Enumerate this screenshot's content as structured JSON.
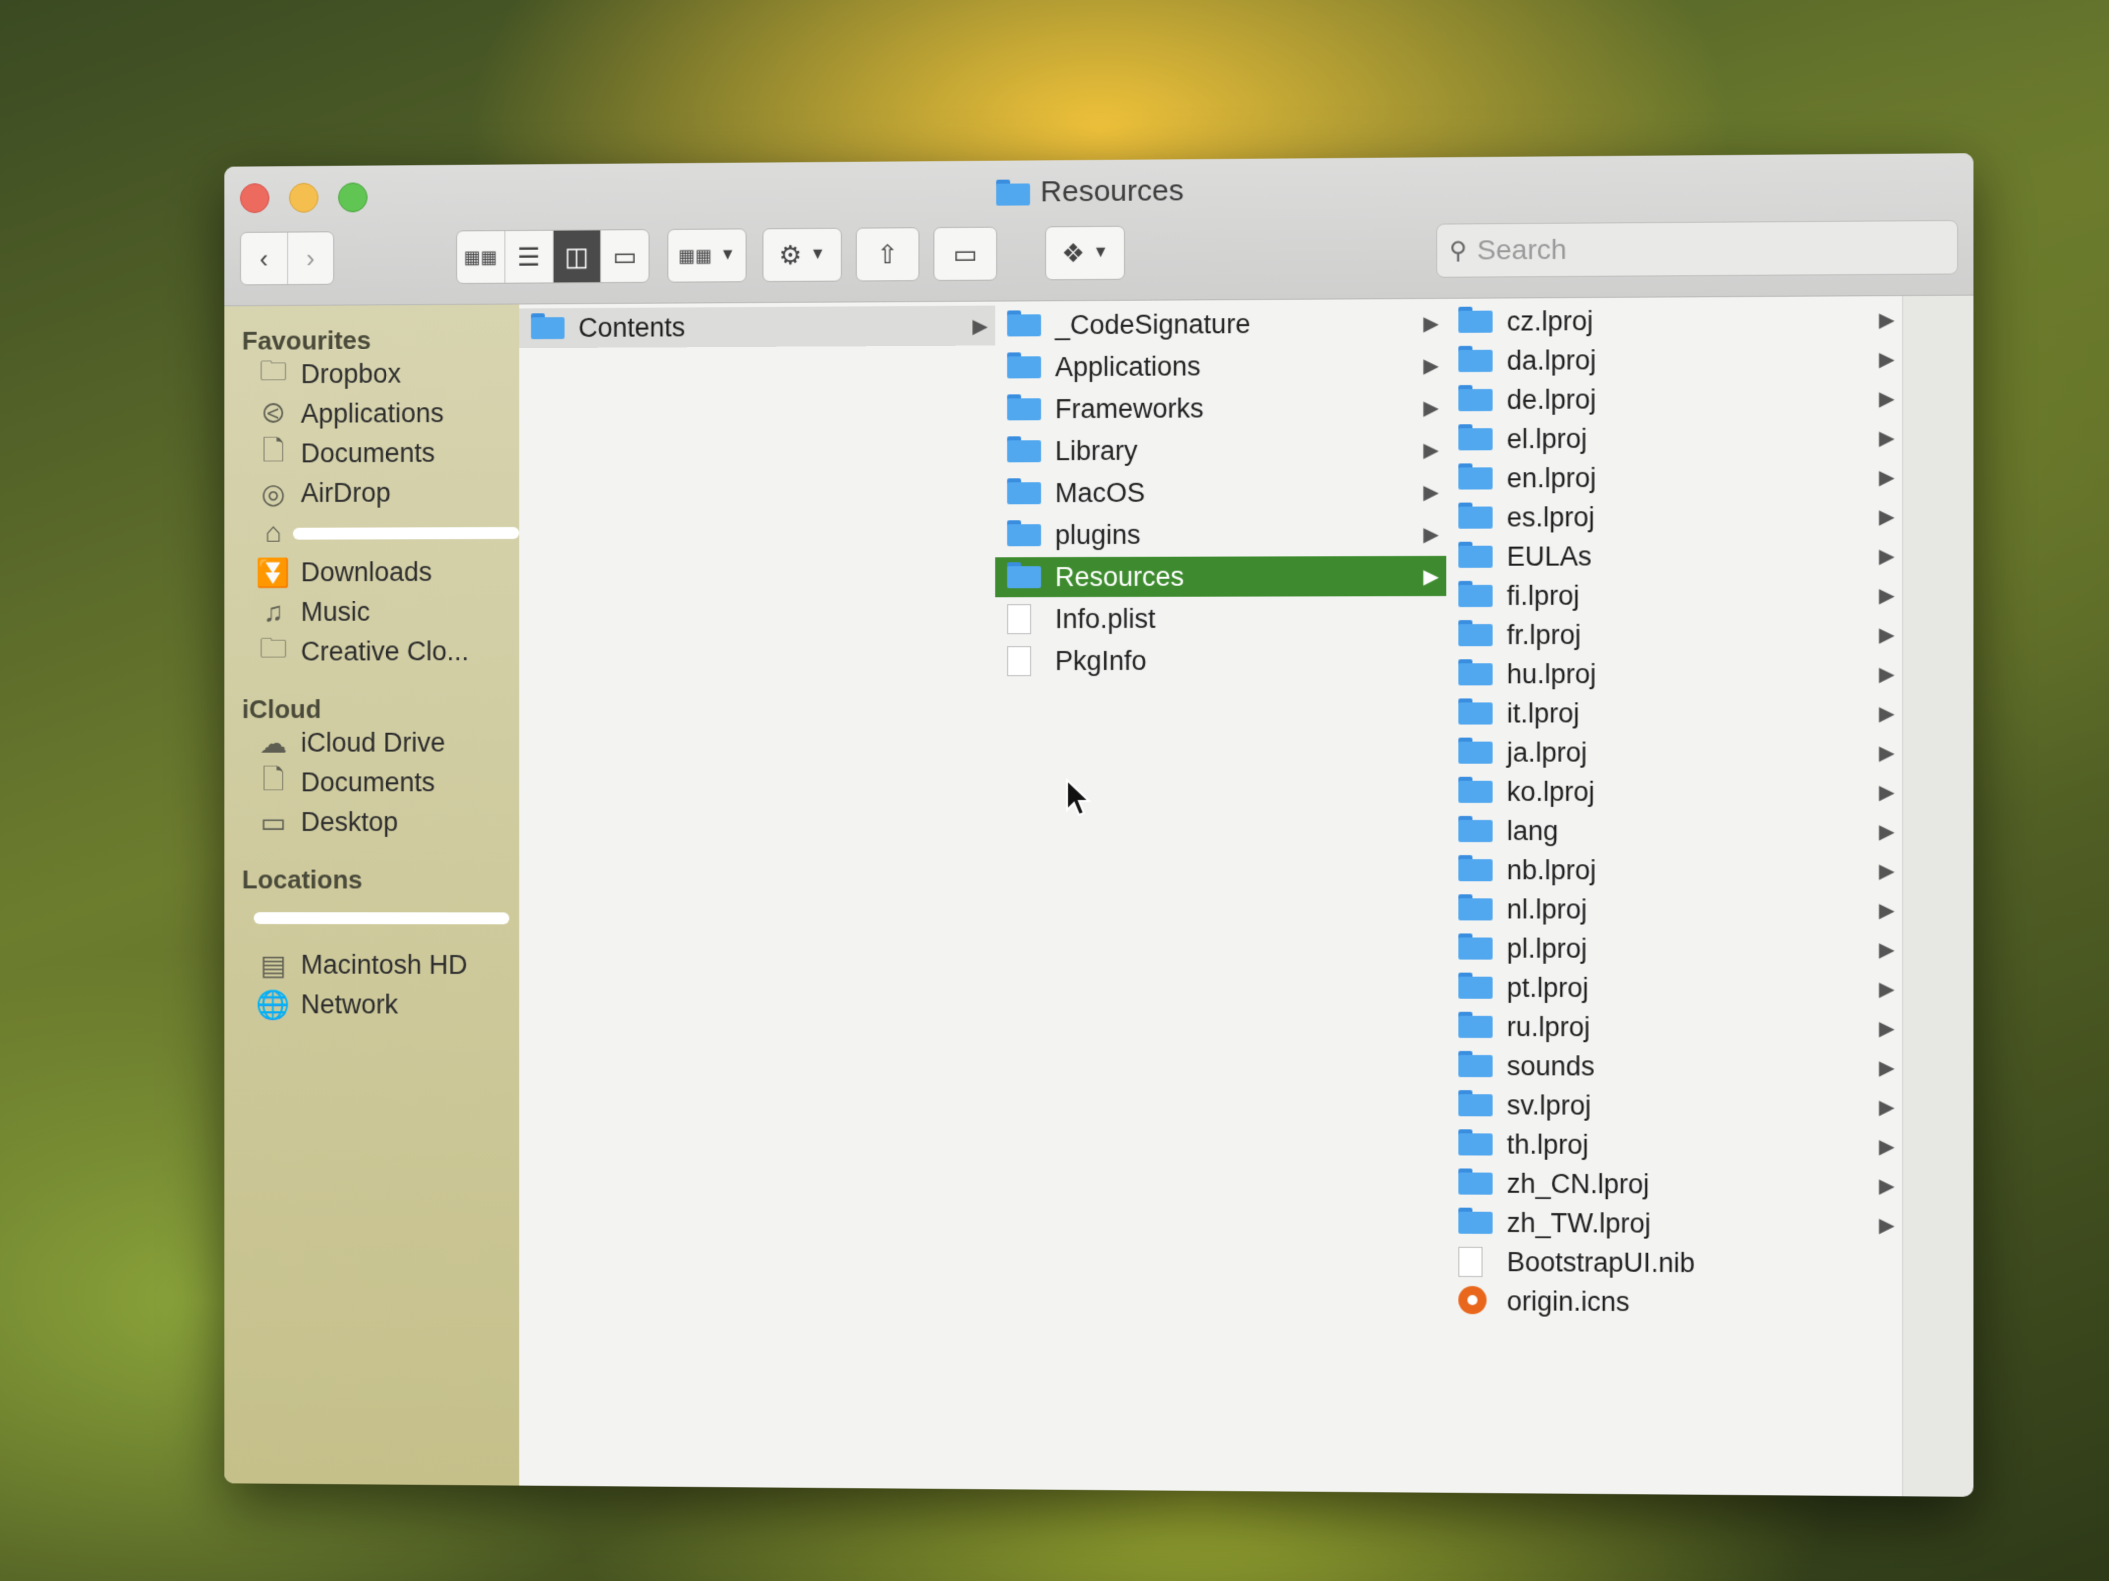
{
  "window": {
    "title": "Resources"
  },
  "search": {
    "placeholder": "Search"
  },
  "sidebar": {
    "favourites_heading": "Favourites",
    "favourites": [
      {
        "label": "Dropbox",
        "icon": "folder-icon"
      },
      {
        "label": "Applications",
        "icon": "applications-icon"
      },
      {
        "label": "Documents",
        "icon": "documents-icon"
      },
      {
        "label": "AirDrop",
        "icon": "airdrop-icon"
      },
      {
        "label": "Downloads",
        "icon": "downloads-icon"
      },
      {
        "label": "Music",
        "icon": "music-icon"
      },
      {
        "label": "Creative Clo...",
        "icon": "folder-icon"
      }
    ],
    "icloud_heading": "iCloud",
    "icloud": [
      {
        "label": "iCloud Drive",
        "icon": "cloud-icon"
      },
      {
        "label": "Documents",
        "icon": "documents-icon"
      },
      {
        "label": "Desktop",
        "icon": "desktop-icon"
      }
    ],
    "locations_heading": "Locations",
    "locations": [
      {
        "label": "Macintosh HD",
        "icon": "harddisk-icon"
      },
      {
        "label": "Network",
        "icon": "network-icon"
      }
    ]
  },
  "columns": {
    "col1": [
      {
        "name": "Contents"
      }
    ],
    "col2": [
      {
        "name": "_CodeSignature"
      },
      {
        "name": "Applications"
      },
      {
        "name": "Frameworks"
      },
      {
        "name": "Library"
      },
      {
        "name": "MacOS"
      },
      {
        "name": "plugins"
      },
      {
        "name": "Resources"
      },
      {
        "name": "Info.plist"
      },
      {
        "name": "PkgInfo"
      }
    ],
    "col3": [
      {
        "name": "cz.lproj"
      },
      {
        "name": "da.lproj"
      },
      {
        "name": "de.lproj"
      },
      {
        "name": "el.lproj"
      },
      {
        "name": "en.lproj"
      },
      {
        "name": "es.lproj"
      },
      {
        "name": "EULAs"
      },
      {
        "name": "fi.lproj"
      },
      {
        "name": "fr.lproj"
      },
      {
        "name": "hu.lproj"
      },
      {
        "name": "it.lproj"
      },
      {
        "name": "ja.lproj"
      },
      {
        "name": "ko.lproj"
      },
      {
        "name": "lang"
      },
      {
        "name": "nb.lproj"
      },
      {
        "name": "nl.lproj"
      },
      {
        "name": "pl.lproj"
      },
      {
        "name": "pt.lproj"
      },
      {
        "name": "ru.lproj"
      },
      {
        "name": "sounds"
      },
      {
        "name": "sv.lproj"
      },
      {
        "name": "th.lproj"
      },
      {
        "name": "zh_CN.lproj"
      },
      {
        "name": "zh_TW.lproj"
      },
      {
        "name": "BootstrapUI.nib"
      },
      {
        "name": "origin.icns"
      }
    ]
  },
  "colors": {
    "selection": "#3e8b2f",
    "folder": "#52a8ef",
    "sidebar": "#d7d4b0"
  }
}
